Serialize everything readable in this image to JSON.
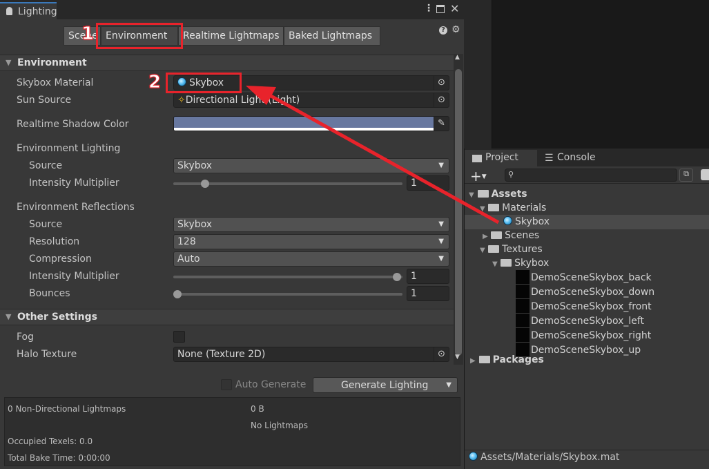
{
  "window": {
    "title": "Lighting",
    "icons": [
      "kebab-menu-icon",
      "maximize-icon",
      "close-icon"
    ]
  },
  "tabs": [
    {
      "label": "Scene"
    },
    {
      "label": "Environment",
      "selected": true
    },
    {
      "label": "Realtime Lightmaps"
    },
    {
      "label": "Baked Lightmaps"
    }
  ],
  "environment": {
    "header": "Environment",
    "skybox_material_label": "Skybox Material",
    "skybox_material": "Skybox",
    "sun_source_label": "Sun Source",
    "sun_source": "Directional Light (Light)",
    "shadow_color_label": "Realtime Shadow Color",
    "shadow_color": "#6878a0",
    "lighting_label": "Environment Lighting",
    "source_label": "Source",
    "lighting_source": "Skybox",
    "intensity_label": "Intensity Multiplier",
    "lighting_intensity": "1",
    "reflections_label": "Environment Reflections",
    "refl_source": "Skybox",
    "resolution_label": "Resolution",
    "resolution": "128",
    "compression_label": "Compression",
    "compression": "Auto",
    "refl_intensity": "1",
    "bounces_label": "Bounces",
    "bounces": "1"
  },
  "other": {
    "header": "Other Settings",
    "fog_label": "Fog",
    "fog": false,
    "halo_label": "Halo Texture",
    "halo": "None (Texture 2D)"
  },
  "footer": {
    "auto_generate": "Auto Generate",
    "generate": "Generate Lighting"
  },
  "stats": {
    "lightmaps": "0 Non-Directional Lightmaps",
    "size": "0 B",
    "no_lightmaps": "No Lightmaps",
    "texels": "Occupied Texels: 0.0",
    "bake_time": "Total Bake Time: 0:00:00"
  },
  "project": {
    "tab_project": "Project",
    "tab_console": "Console",
    "search_placeholder": "",
    "tree": {
      "assets": "Assets",
      "materials": "Materials",
      "skybox_mat": "Skybox",
      "scenes": "Scenes",
      "textures": "Textures",
      "skybox_folder": "Skybox",
      "textures_list": [
        "DemoSceneSkybox_back",
        "DemoSceneSkybox_down",
        "DemoSceneSkybox_front",
        "DemoSceneSkybox_left",
        "DemoSceneSkybox_right",
        "DemoSceneSkybox_up"
      ],
      "packages": "Packages"
    },
    "status_path": "Assets/Materials/Skybox.mat"
  },
  "annotations": {
    "step1": "1",
    "step2": "2",
    "color": "#e8232b"
  }
}
